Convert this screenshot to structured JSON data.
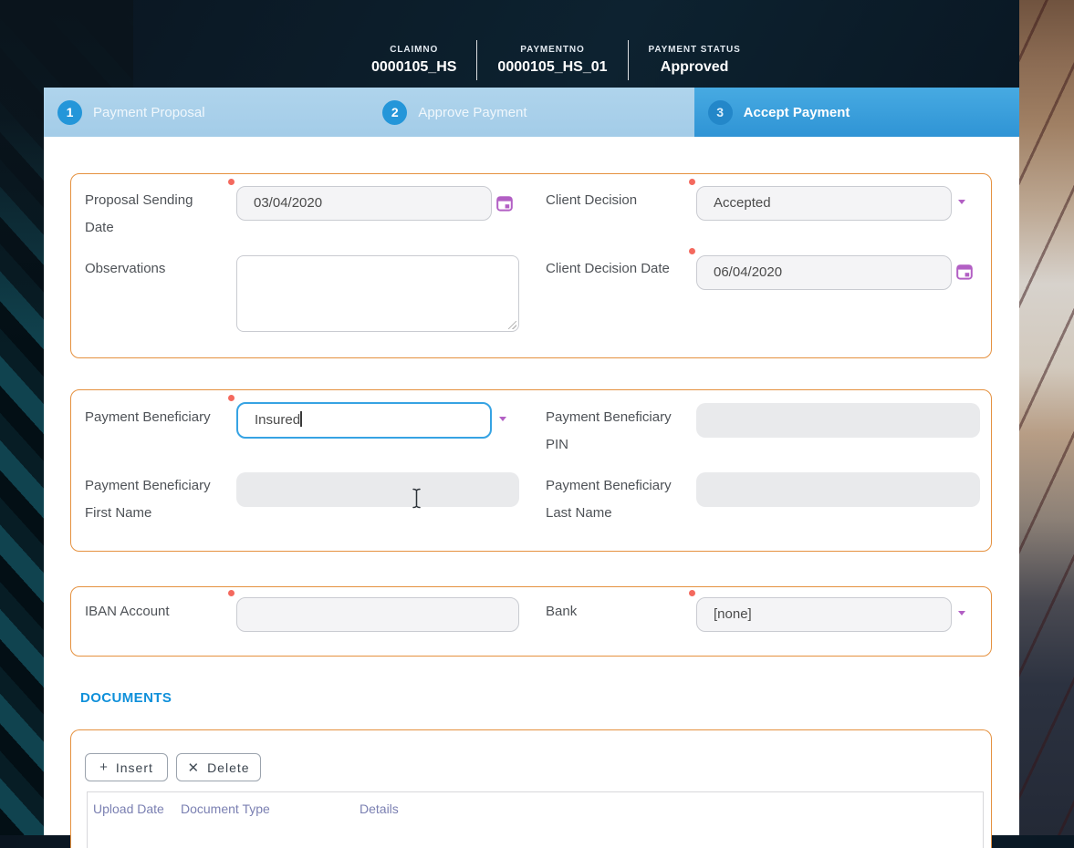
{
  "header": {
    "fields": [
      {
        "label": "CLAIMNO",
        "value": "0000105_HS"
      },
      {
        "label": "PAYMENTNO",
        "value": "0000105_HS_01"
      },
      {
        "label": "PAYMENT STATUS",
        "value": "Approved"
      }
    ]
  },
  "wizard": {
    "active_step": "3",
    "steps": [
      {
        "number": "1",
        "label": "Payment Proposal"
      },
      {
        "number": "2",
        "label": "Approve Payment"
      },
      {
        "number": "3",
        "label": "Accept Payment"
      }
    ]
  },
  "form": {
    "proposal_section": {
      "proposal_sending_date": {
        "label": "Proposal Sending Date",
        "value": "03/04/2020",
        "required": true
      },
      "client_decision": {
        "label": "Client Decision",
        "value": "Accepted",
        "required": true
      },
      "observations": {
        "label": "Observations",
        "value": ""
      },
      "client_decision_date": {
        "label": "Client Decision Date",
        "value": "06/04/2020",
        "required": true
      }
    },
    "beneficiary_section": {
      "payment_beneficiary": {
        "label": "Payment Beneficiary",
        "value": "Insured",
        "required": true
      },
      "beneficiary_pin": {
        "label": "Payment Beneficiary PIN",
        "value": ""
      },
      "beneficiary_first_name": {
        "label": "Payment Beneficiary First Name",
        "value": ""
      },
      "beneficiary_last_name": {
        "label": "Payment Beneficiary Last Name",
        "value": ""
      }
    },
    "bank_section": {
      "iban_account": {
        "label": "IBAN Account",
        "value": "",
        "required": true
      },
      "bank": {
        "label": "Bank",
        "value": "[none]",
        "required": true
      }
    }
  },
  "documents": {
    "heading": "DOCUMENTS",
    "insert_button": "Insert",
    "delete_button": "Delete",
    "insert_icon": "+",
    "delete_icon": "✕",
    "table": {
      "columns": [
        "Upload Date",
        "Document Type",
        "Details"
      ],
      "rows": []
    }
  },
  "colors": {
    "section_border_orange": "#e5913f",
    "accent_purple": "#b25fc4",
    "focus_blue": "#36a3e3",
    "step_active_blue": "#359ddd",
    "step_inactive_blue": "#a6cde9",
    "step_circle_blue": "#2496d9",
    "documents_heading_blue": "#0f90da",
    "required_dot_red": "#f4695e",
    "table_header_text": "#7b80b2"
  }
}
